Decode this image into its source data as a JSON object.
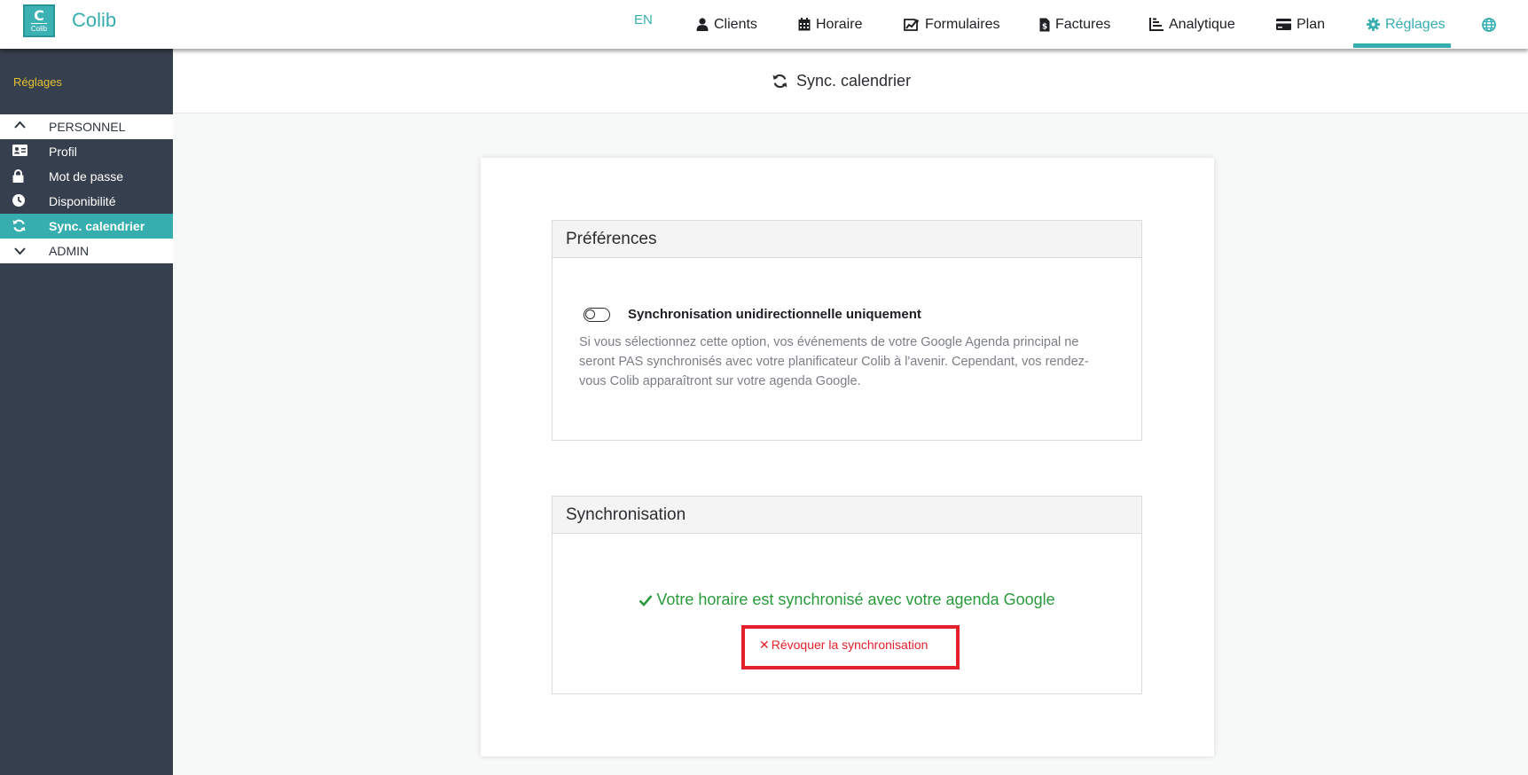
{
  "app": {
    "brand": "Colib",
    "logo_text": "Colib"
  },
  "nav": {
    "lang": "EN",
    "items": [
      {
        "label": "Clients",
        "icon": "user-icon"
      },
      {
        "label": "Horaire",
        "icon": "calendar-icon"
      },
      {
        "label": "Formulaires",
        "icon": "form-chart-icon"
      },
      {
        "label": "Factures",
        "icon": "invoice-icon"
      },
      {
        "label": "Analytique",
        "icon": "chart-icon"
      },
      {
        "label": "Plan",
        "icon": "credit-card-icon"
      },
      {
        "label": "Réglages",
        "icon": "gear-icon",
        "active": true
      }
    ],
    "globe_icon": "globe-icon"
  },
  "sidebar": {
    "title": "Réglages",
    "sections": [
      {
        "label": "PERSONNEL",
        "icon": "chevron-up-icon"
      },
      {
        "label": "ADMIN",
        "icon": "chevron-down-icon"
      }
    ],
    "items": [
      {
        "label": "Profil",
        "icon": "id-card-icon"
      },
      {
        "label": "Mot de passe",
        "icon": "lock-icon"
      },
      {
        "label": "Disponibilité",
        "icon": "clock-icon"
      },
      {
        "label": "Sync. calendrier",
        "icon": "sync-icon",
        "active": true
      }
    ]
  },
  "page": {
    "title": "Sync. calendrier"
  },
  "preferences": {
    "heading": "Préférences",
    "toggle_label": "Synchronisation unidirectionnelle uniquement",
    "toggle_on": false,
    "description": "Si vous sélectionnez cette option, vos événements de votre Google Agenda principal ne seront PAS synchronisés avec votre planificateur Colib à l'avenir. Cependant, vos rendez-vous Colib apparaîtront sur votre agenda Google."
  },
  "synchronisation": {
    "heading": "Synchronisation",
    "status": "Votre horaire est synchronisé avec votre agenda Google",
    "revoke_label": "Révoquer la synchronisation"
  },
  "colors": {
    "accent": "#36aeb0",
    "sidebar": "#363f4d",
    "success": "#2a9a3c",
    "danger": "#e3202b",
    "sidebar_title": "#e4c231"
  }
}
